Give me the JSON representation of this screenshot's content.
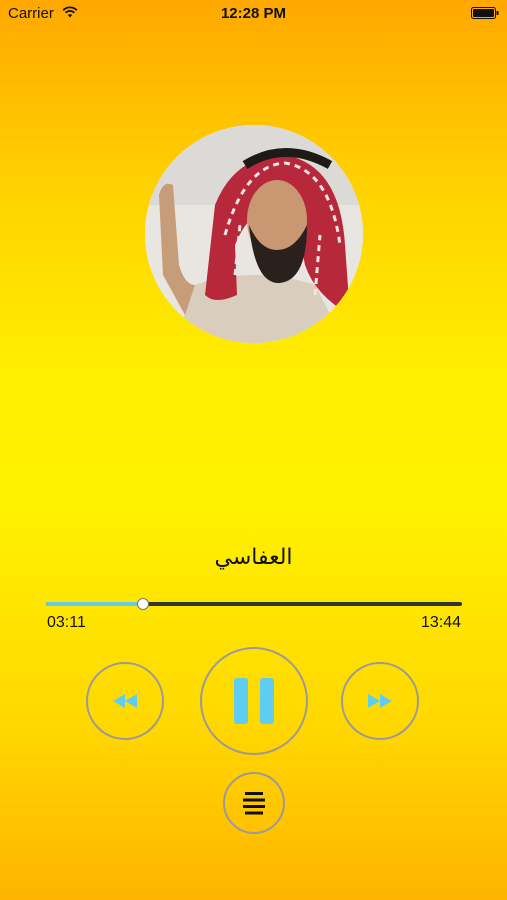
{
  "status_bar": {
    "carrier": "Carrier",
    "time": "12:28 PM",
    "icons": [
      "wifi-icon",
      "battery-icon"
    ]
  },
  "player": {
    "artwork": "reciter-portrait",
    "title": "العفاسي",
    "elapsed": "03:11",
    "duration": "13:44",
    "progress_fraction": 0.232,
    "controls": [
      "rewind-icon",
      "pause-icon",
      "fast-forward-icon",
      "playlist-icon"
    ]
  },
  "colors": {
    "accent": "#5ecdf0",
    "background_top": "#ffa800",
    "background_mid": "#fff200",
    "background_bottom": "#ffb400",
    "button_outline": "#9a9a9a"
  }
}
